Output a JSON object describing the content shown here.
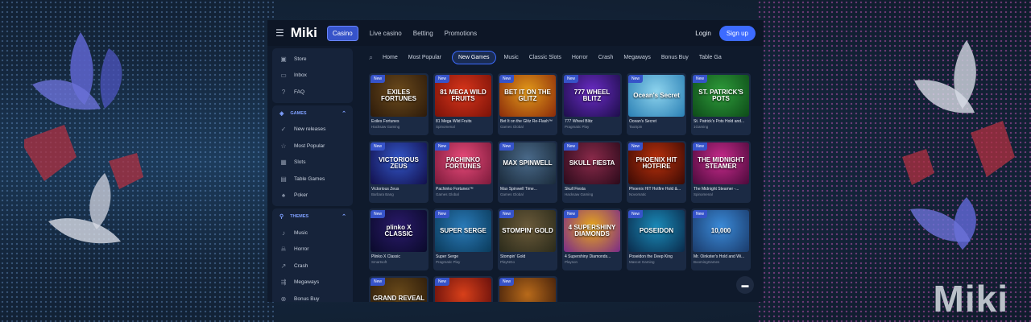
{
  "brand": "Miki",
  "topbar": {
    "menu_icon": "hamburger-icon",
    "logo": "Miki",
    "nav": [
      {
        "label": "Casino",
        "active": true
      },
      {
        "label": "Live casino",
        "active": false
      },
      {
        "label": "Betting",
        "active": false
      },
      {
        "label": "Promotions",
        "active": false
      }
    ],
    "login": "Login",
    "signup": "Sign up"
  },
  "sidebar": {
    "top": [
      {
        "label": "Store",
        "icon": "store-icon"
      },
      {
        "label": "Inbox",
        "icon": "inbox-icon"
      },
      {
        "label": "FAQ",
        "icon": "help-icon"
      }
    ],
    "games_title": "GAMES",
    "games": [
      {
        "label": "New releases",
        "icon": "new-icon"
      },
      {
        "label": "Most Popular",
        "icon": "star-icon"
      },
      {
        "label": "Slots",
        "icon": "slots-icon"
      },
      {
        "label": "Table Games",
        "icon": "table-icon"
      },
      {
        "label": "Poker",
        "icon": "poker-icon"
      }
    ],
    "themes_title": "THEMES",
    "themes": [
      {
        "label": "Music",
        "icon": "music-icon"
      },
      {
        "label": "Horror",
        "icon": "horror-icon"
      },
      {
        "label": "Crash",
        "icon": "crash-icon"
      },
      {
        "label": "Megaways",
        "icon": "megaways-icon"
      },
      {
        "label": "Bonus Buy",
        "icon": "bonus-icon"
      }
    ]
  },
  "filters": [
    "Home",
    "Most Popular",
    "New Games",
    "Music",
    "Classic Slots",
    "Horror",
    "Crash",
    "Megaways",
    "Bonus Buy",
    "Table Ga"
  ],
  "active_filter": "New Games",
  "badge": "New",
  "games": [
    {
      "title": "Exiles Fortunes",
      "provider": "Hacksaw Gaming",
      "art": "EXILES FORTUNES",
      "c1": "#6b4a1c",
      "c2": "#2c1a0a"
    },
    {
      "title": "81 Mega Wild Fruits",
      "provider": "Spinomenal",
      "art": "81 MEGA WILD FRUITS",
      "c1": "#d8351b",
      "c2": "#7a1208"
    },
    {
      "title": "Bet It on the Glitz Re-Flash™",
      "provider": "Games Global",
      "art": "BET IT ON THE GLITZ",
      "c1": "#e39a1a",
      "c2": "#8a2a0a"
    },
    {
      "title": "777 Wheel Blitz",
      "provider": "Pragmatic Play",
      "art": "777 WHEEL BLITZ",
      "c1": "#6a2bc4",
      "c2": "#1d0e4a"
    },
    {
      "title": "Ocean's Secret",
      "provider": "TaoSpin",
      "art": "Ocean's Secret",
      "c1": "#8ed4ee",
      "c2": "#2a7fb4"
    },
    {
      "title": "St. Patrick's Pots Hold and...",
      "provider": "1Gaming",
      "art": "ST. PATRICK'S POTS",
      "c1": "#2e9c3a",
      "c2": "#0d4a18"
    },
    {
      "title": "Victorious Zeus",
      "provider": "Barbara Bang",
      "art": "VICTORIOUS ZEUS",
      "c1": "#3256c8",
      "c2": "#120f4a"
    },
    {
      "title": "Pachinko Fortunes™",
      "provider": "Games Global",
      "art": "PACHINKO FORTUNES",
      "c1": "#e94a7a",
      "c2": "#7a1a3a"
    },
    {
      "title": "Max Spinwell Time...",
      "provider": "Games Global",
      "art": "MAX SPINWELL",
      "c1": "#4a6a8a",
      "c2": "#1a2a3a"
    },
    {
      "title": "Skull Fiesta",
      "provider": "Hacksaw Gaming",
      "art": "SKULL FIESTA",
      "c1": "#8a2a4a",
      "c2": "#2a0a1a"
    },
    {
      "title": "Phoenix HIT Hotfire Hold &...",
      "provider": "Novomatic",
      "art": "PHOENIX HIT HOTFIRE",
      "c1": "#b8300c",
      "c2": "#3a0a04"
    },
    {
      "title": "The Midnight Steamer -...",
      "provider": "Spinomenal",
      "art": "THE MIDNIGHT STEAMER",
      "c1": "#c82a8c",
      "c2": "#4a0a3a"
    },
    {
      "title": "Plinko X Classic",
      "provider": "Smartsoft",
      "art": "plinko X CLASSIC",
      "c1": "#2a1a6a",
      "c2": "#0a0a2a"
    },
    {
      "title": "Super Serge",
      "provider": "Pragmatic Play",
      "art": "SUPER SERGE",
      "c1": "#2a7ab8",
      "c2": "#0a3a5a"
    },
    {
      "title": "Stompin' Gold",
      "provider": "PlayNGo",
      "art": "STOMPIN' GOLD",
      "c1": "#6a5a3a",
      "c2": "#2a2a1a"
    },
    {
      "title": "4 Supershiny Diamonds...",
      "provider": "Playson",
      "art": "4 SUPERSHINY DIAMONDS",
      "c1": "#e8a81a",
      "c2": "#7a2a8a"
    },
    {
      "title": "Poseidon the Deep King",
      "provider": "Mascot Gaming",
      "art": "POSEIDON",
      "c1": "#1a8ab8",
      "c2": "#0a2a4a"
    },
    {
      "title": "Mr. Oinkster's Hold and Wi...",
      "provider": "BoomingGames",
      "art": "10,000",
      "c1": "#3a8ad8",
      "c2": "#1a3a6a"
    },
    {
      "title": "",
      "provider": "",
      "art": "GRAND REVEAL",
      "c1": "#6a4a1a",
      "c2": "#2a1a0a"
    },
    {
      "title": "",
      "provider": "",
      "art": "",
      "c1": "#d8401a",
      "c2": "#5a0a0a"
    },
    {
      "title": "",
      "provider": "",
      "art": "",
      "c1": "#b86a1a",
      "c2": "#3a1a0a"
    }
  ],
  "colors": {
    "accent": "#3d6bff",
    "badge": "#3653c9",
    "panel": "#16233a",
    "bg": "#0f1a2c"
  }
}
